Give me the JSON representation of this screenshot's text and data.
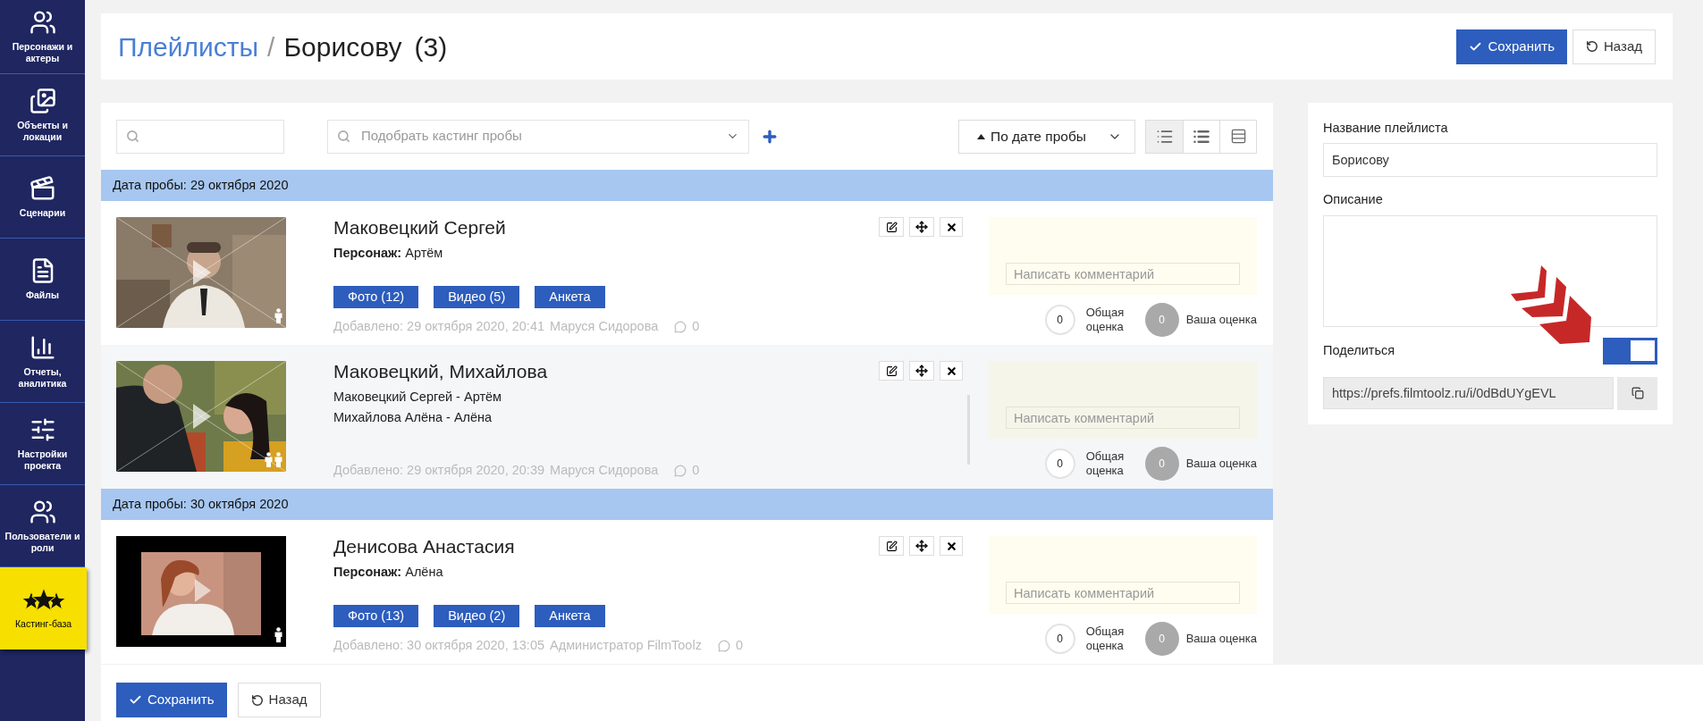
{
  "sidebar": {
    "items": [
      {
        "label": "Персонажи и актеры",
        "kind": "people",
        "selected": false
      },
      {
        "label": "Объекты и локации",
        "kind": "images",
        "selected": false
      },
      {
        "label": "Сценарии",
        "kind": "clapper",
        "selected": false
      },
      {
        "label": "Файлы",
        "kind": "file",
        "selected": false
      },
      {
        "label": "Отчеты, аналитика",
        "kind": "chart",
        "selected": false
      },
      {
        "label": "Настройки проекта",
        "kind": "sliders",
        "selected": false
      },
      {
        "label": "Пользователи и роли",
        "kind": "people",
        "selected": false
      },
      {
        "label": "Кастинг-база",
        "kind": "stars",
        "selected": true
      }
    ]
  },
  "header": {
    "breadcrumb": "Плейлисты",
    "separator": "/",
    "title": "Борисову",
    "count": "(3)",
    "save_button": "Сохранить",
    "back_button": "Назад"
  },
  "toolbar": {
    "pick_placeholder": "Подобрать кастинг пробы",
    "sort": "По дате пробы",
    "views": [
      {
        "kind": "detailed",
        "selected": true
      },
      {
        "kind": "list",
        "selected": false
      },
      {
        "kind": "table",
        "selected": false
      }
    ]
  },
  "groups": [
    {
      "date": "Дата пробы: 29 октября 2020",
      "entries": [
        {
          "title": "Маковецкий Сергей",
          "kind": "single",
          "hovered": false,
          "lines": [
            "**Персонаж:** Артём"
          ],
          "buttons": [
            "Фото (12)",
            "Видео (5)",
            "Анкета"
          ],
          "added": "Добавлено: 29 октября 2020, 20:41",
          "author": "Маруся Сидорова",
          "comments": "0",
          "comment_placeholder": "Написать комментарий",
          "overall": "0",
          "overall_label": "Общая оценка",
          "mine": "0",
          "mine_label": "Ваша оценка"
        },
        {
          "title": "Маковецкий, Михайлова",
          "kind": "pair",
          "hovered": true,
          "lines": [
            "Маковецкий Сергей - Артём",
            "Михайлова Алёна - Алёна"
          ],
          "added": "Добавлено: 29 октября 2020, 20:39",
          "author": "Маруся Сидорова",
          "comments": "0",
          "comment_placeholder": "Написать комментарий",
          "overall": "0",
          "overall_label": "Общая оценка",
          "mine": "0",
          "mine_label": "Ваша оценка"
        }
      ]
    },
    {
      "date": "Дата пробы: 30 октября 2020",
      "entries": [
        {
          "title": "Денисова Анастасия",
          "kind": "single",
          "hovered": false,
          "lines": [
            "**Персонаж:** Алёна"
          ],
          "buttons": [
            "Фото (13)",
            "Видео (2)",
            "Анкета"
          ],
          "added": "Добавлено: 30 октября 2020, 13:05",
          "author": "Администратор FilmToolz",
          "comments": "0",
          "comment_placeholder": "Написать комментарий",
          "overall": "0",
          "overall_label": "Общая оценка",
          "mine": "0",
          "mine_label": "Ваша оценка"
        }
      ]
    }
  ],
  "playlist": {
    "name_label": "Название плейлиста",
    "name_value": "Борисову",
    "description_label": "Описание",
    "share_label": "Поделиться",
    "share_on": true,
    "link": "https://prefs.filmtoolz.ru/i/0dBdUYgEVL"
  },
  "footer": {
    "save_button": "Сохранить",
    "back_button": "Назад"
  }
}
